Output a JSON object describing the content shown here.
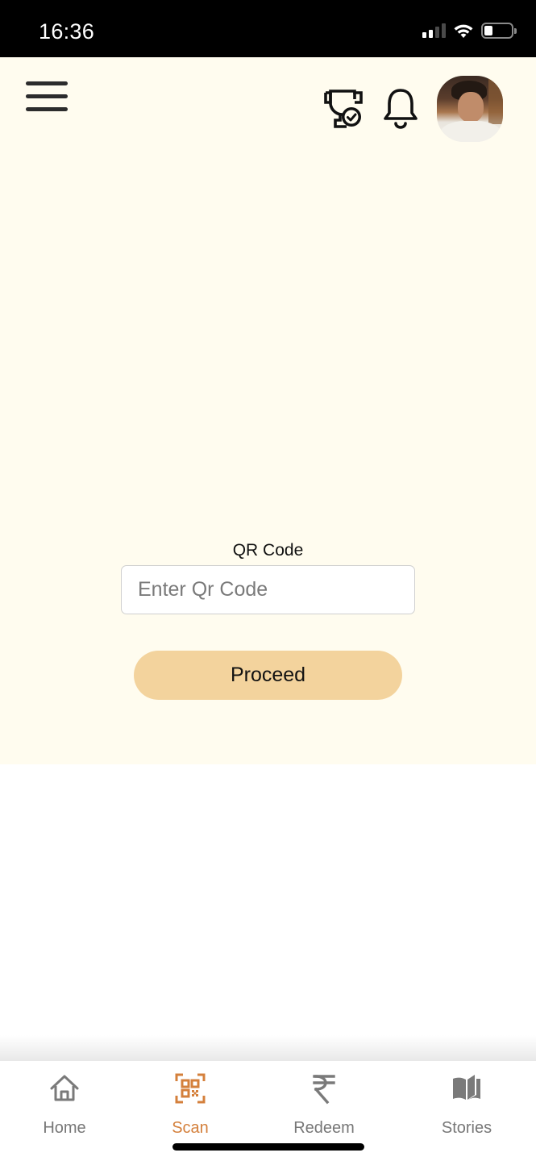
{
  "status_bar": {
    "time": "16:36",
    "signal_bars_active": 2,
    "signal_bars_total": 4,
    "wifi": "wifi-icon",
    "battery_level_percent": 30
  },
  "header": {
    "menu_icon": "hamburger-menu-icon",
    "trophy_icon": "trophy-check-icon",
    "bell_icon": "bell-icon",
    "avatar_alt": "User profile photo"
  },
  "form": {
    "label": "QR Code",
    "input_value": "",
    "input_placeholder": "Enter Qr Code",
    "submit_label": "Proceed"
  },
  "colors": {
    "background_cream": "#fffcef",
    "button_fill": "#f3d39d",
    "accent_active": "#d4803c",
    "nav_inactive": "#777777"
  },
  "bottom_nav": {
    "active": "Scan",
    "items": [
      {
        "label": "Home",
        "icon": "home-icon"
      },
      {
        "label": "Scan",
        "icon": "qr-scan-icon"
      },
      {
        "label": "Redeem",
        "icon": "rupee-icon"
      },
      {
        "label": "Stories",
        "icon": "book-icon"
      }
    ]
  }
}
